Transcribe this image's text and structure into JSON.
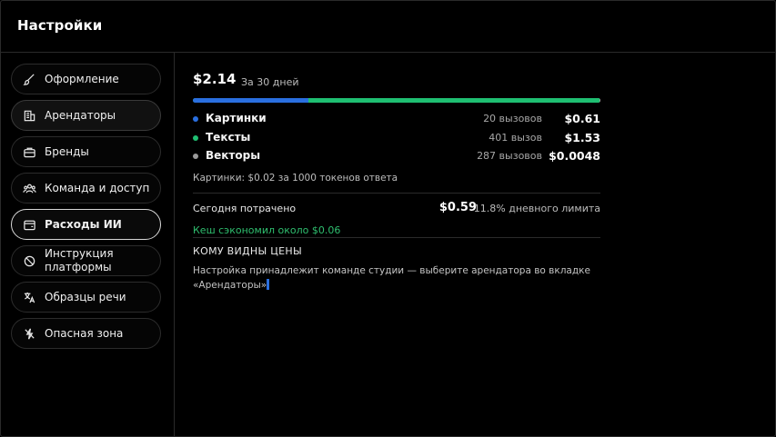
{
  "header": {
    "title": "Настройки"
  },
  "sidebar": {
    "items": [
      {
        "label": "Оформление",
        "icon": "brush-icon"
      },
      {
        "label": "Арендаторы",
        "icon": "building-icon"
      },
      {
        "label": "Бренды",
        "icon": "briefcase-icon"
      },
      {
        "label": "Команда и доступ",
        "icon": "team-icon"
      },
      {
        "label": "Расходы ИИ",
        "icon": "wallet-icon",
        "selected": true
      },
      {
        "label": "Инструкция платформы",
        "icon": "block-icon"
      },
      {
        "label": "Образцы речи",
        "icon": "translate-icon"
      },
      {
        "label": "Опасная зона",
        "icon": "danger-icon"
      }
    ]
  },
  "costs": {
    "total": "$2.14",
    "period": "За 30 дней",
    "breakdown": [
      {
        "label": "Картинки",
        "calls": "20 вызовов",
        "cost": "$0.61",
        "color": "#2a6fe0",
        "share": 0.285
      },
      {
        "label": "Тексты",
        "calls": "401 вызов",
        "cost": "$1.53",
        "color": "#1fbf72",
        "share": 0.715
      },
      {
        "label": "Векторы",
        "calls": "287 вызовов",
        "cost": "$0.0048",
        "color": "#9a9a9a",
        "share": 0.002
      }
    ],
    "note": "Картинки: $0.02 за 1000 токенов ответа",
    "today": {
      "label": "Сегодня потрачено",
      "amount": "$0.59",
      "limit": "11.8% дневного лимита"
    },
    "cache_note": "Кеш сэкономил около $0.06",
    "visibility": {
      "title": "КОМУ ВИДНЫ ЦЕНЫ",
      "text": "Настройка принадлежит команде студии — выберите арендатора во вкладке «Арендаторы»"
    }
  }
}
